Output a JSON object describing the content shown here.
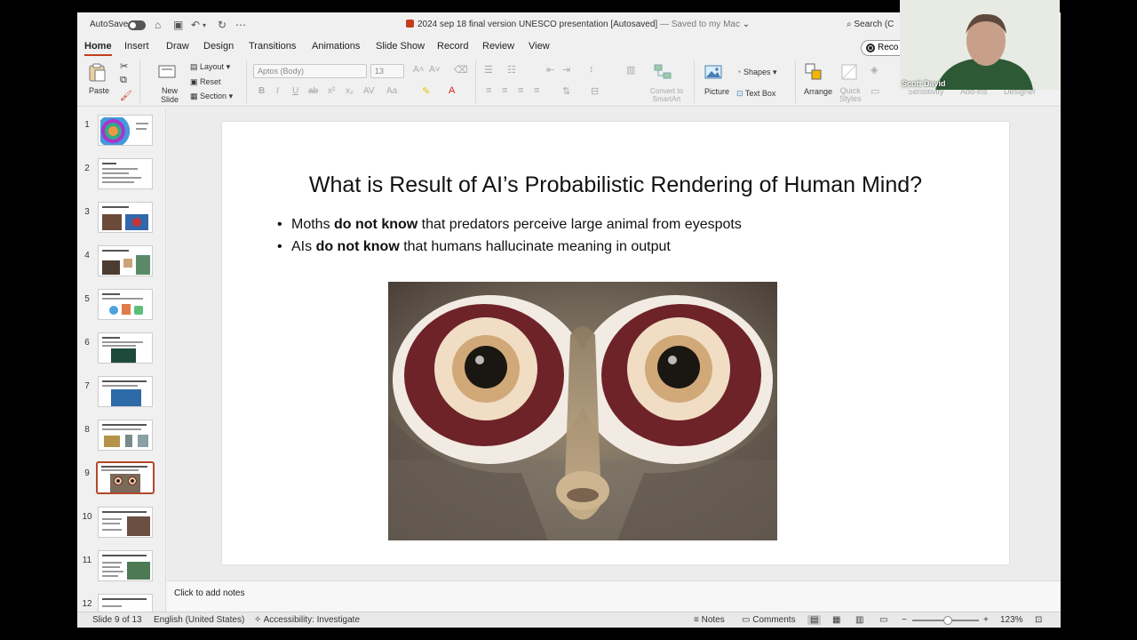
{
  "titlebar": {
    "autosave_label": "AutoSave",
    "document_title": "2024 sep 18 final version UNESCO presentation [Autosaved]",
    "saved_status": "— Saved to my Mac",
    "search_placeholder": "Search (C"
  },
  "ribbon_tabs": [
    "Home",
    "Insert",
    "Draw",
    "Design",
    "Transitions",
    "Animations",
    "Slide Show",
    "Record",
    "Review",
    "View"
  ],
  "record_button_label": "Reco",
  "ribbon": {
    "paste_label": "Paste",
    "new_slide_label": "New\nSlide",
    "layout_label": "Layout",
    "reset_label": "Reset",
    "section_label": "Section",
    "font_name": "Aptos (Body)",
    "font_size": "13",
    "convert_smartart_label": "Convert to\nSmartArt",
    "picture_label": "Picture",
    "shapes_label": "Shapes",
    "text_box_label": "Text Box",
    "arrange_label": "Arrange",
    "quick_styles_label": "Quick\nStyles",
    "sensitivity_label": "Sensitivity",
    "add_ins_label": "Add-ins",
    "designer_label": "Designer"
  },
  "thumbnails": [
    "1",
    "2",
    "3",
    "4",
    "5",
    "6",
    "7",
    "8",
    "9",
    "10",
    "11",
    "12"
  ],
  "selected_slide_index": 9,
  "slide": {
    "title": "What is Result of AI’s Probabilistic Rendering of Human Mind?",
    "bullets": [
      {
        "pre": "Moths ",
        "bold": "do not know",
        "post": " that predators perceive large animal from eyespots"
      },
      {
        "pre": "AIs ",
        "bold": "do not know",
        "post": " that humans hallucinate meaning in output"
      }
    ]
  },
  "notes_placeholder": "Click to add notes",
  "statusbar": {
    "slide_counter": "Slide 9 of 13",
    "language": "English (United States)",
    "accessibility": "Accessibility: Investigate",
    "notes_label": "Notes",
    "comments_label": "Comments",
    "zoom_minus": "−",
    "zoom_plus": "+",
    "zoom_level": "123%"
  },
  "webcam": {
    "participant_name": "Scott David"
  },
  "colors": {
    "accent": "#c43e1c",
    "selected_thumb_border": "#b5472a"
  }
}
